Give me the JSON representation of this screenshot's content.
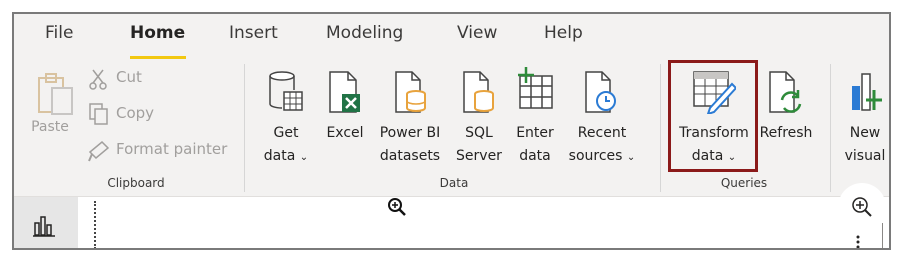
{
  "tabs": [
    "File",
    "Home",
    "Insert",
    "Modeling",
    "View",
    "Help"
  ],
  "clipboard": {
    "paste": "Paste",
    "cut": "Cut",
    "copy": "Copy",
    "format_painter": "Format painter",
    "group_label": "Clipboard"
  },
  "data_group": {
    "get_data": [
      "Get",
      "data"
    ],
    "excel": "Excel",
    "power_bi_datasets": [
      "Power BI",
      "datasets"
    ],
    "sql_server": [
      "SQL",
      "Server"
    ],
    "enter_data": [
      "Enter",
      "data"
    ],
    "recent_sources": [
      "Recent",
      "sources"
    ],
    "group_label": "Data"
  },
  "queries": {
    "transform_data": [
      "Transform",
      "data"
    ],
    "refresh": "Refresh",
    "group_label": "Queries"
  },
  "insert": {
    "new_visual": [
      "New",
      "visual"
    ]
  },
  "caret": "⌄",
  "colors": {
    "highlight": "#8b1a1a",
    "tab_underline": "#f2c811",
    "excel_green": "#217346",
    "accent_orange": "#e8a33d",
    "refresh_green": "#2e8b3a",
    "pencil_blue": "#2b7bd4"
  }
}
